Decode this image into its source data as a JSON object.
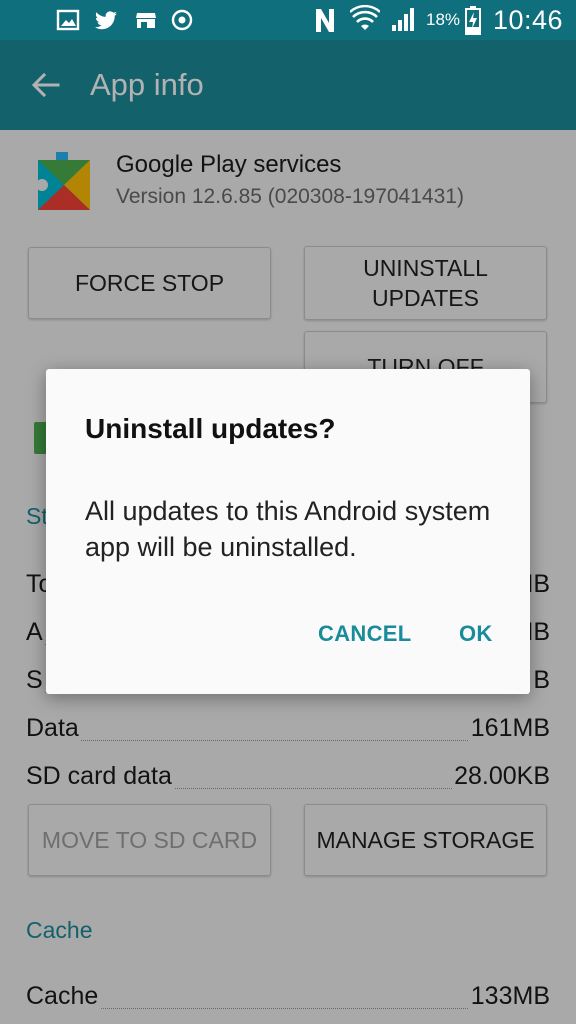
{
  "status_bar": {
    "battery_percent": "18%",
    "time": "10:46",
    "left_icons": [
      "gallery-icon",
      "twitter-icon",
      "store-icon",
      "sync-icon"
    ],
    "right_icons": [
      "nfc-icon",
      "wifi-icon",
      "signal-icon",
      "battery-charging-icon"
    ]
  },
  "app_bar": {
    "title": "App info",
    "back_icon": "arrow-back-icon"
  },
  "app": {
    "name": "Google Play services",
    "version": "Version 12.6.85 (020308-197041431)",
    "icon": "play-services-icon"
  },
  "buttons": {
    "force_stop": "FORCE STOP",
    "uninstall_updates": "UNINSTALL UPDATES",
    "turn_off": "TURN OFF",
    "move_to_sd": "MOVE TO SD CARD",
    "manage_storage": "MANAGE STORAGE"
  },
  "storage": {
    "section_label_fragment": "St",
    "rows": [
      {
        "label": "To",
        "value": "MB"
      },
      {
        "label": "A",
        "value": "MB"
      },
      {
        "label": "S",
        "value": "B"
      },
      {
        "label": "Data",
        "value": "161MB"
      },
      {
        "label": "SD card data",
        "value": "28.00KB"
      }
    ]
  },
  "cache": {
    "section_label": "Cache",
    "row": {
      "label": "Cache",
      "value": "133MB"
    }
  },
  "dialog": {
    "title": "Uninstall updates?",
    "message": "All updates to this Android system app will be uninstalled.",
    "cancel": "CANCEL",
    "ok": "OK"
  },
  "colors": {
    "status_bar": "#0f6f7c",
    "app_bar": "#1a8b9a",
    "accent": "#1a8b9a",
    "checkbox": "#4caf50"
  }
}
